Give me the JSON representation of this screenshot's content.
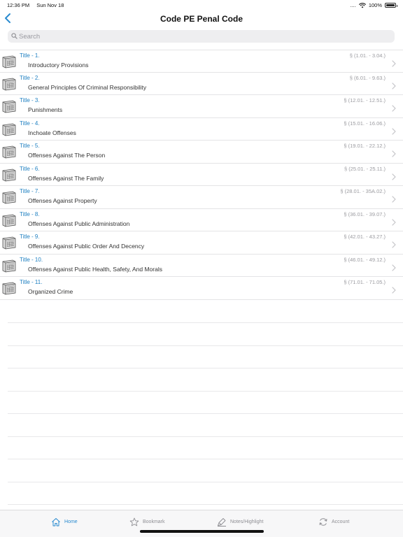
{
  "status": {
    "time": "12:36 PM",
    "date": "Sun Nov 18",
    "signal": "....",
    "battery": "100%"
  },
  "nav": {
    "title": "Code PE Penal Code"
  },
  "search": {
    "placeholder": "Search"
  },
  "titles": [
    {
      "title": "Title - 1.",
      "name": "Introductory Provisions",
      "range": "§ (1.01. - 3.04.)"
    },
    {
      "title": "Title - 2.",
      "name": "General Principles Of Criminal Responsibility",
      "range": "§ (6.01. - 9.63.)"
    },
    {
      "title": "Title - 3.",
      "name": "Punishments",
      "range": "§ (12.01. - 12.51.)"
    },
    {
      "title": "Title - 4.",
      "name": "Inchoate Offenses",
      "range": "§ (15.01. - 16.06.)"
    },
    {
      "title": "Title - 5.",
      "name": "Offenses Against The Person",
      "range": "§ (19.01. - 22.12.)"
    },
    {
      "title": "Title - 6.",
      "name": "Offenses Against The Family",
      "range": "§ (25.01. - 25.11.)"
    },
    {
      "title": "Title - 7.",
      "name": "Offenses Against Property",
      "range": "§ (28.01. - 35A.02.)"
    },
    {
      "title": "Title - 8.",
      "name": "Offenses Against Public Administration",
      "range": "§ (36.01. - 39.07.)"
    },
    {
      "title": "Title - 9.",
      "name": "Offenses Against Public Order And Decency",
      "range": "§ (42.01. - 43.27.)"
    },
    {
      "title": "Title - 10.",
      "name": "Offenses Against Public Health, Safety, And Morals",
      "range": "§ (46.01. - 49.12.)"
    },
    {
      "title": "Title - 11.",
      "name": "Organized Crime",
      "range": "§ (71.01. - 71.05.)"
    }
  ],
  "tabs": [
    {
      "label": "Home",
      "icon": "home-icon",
      "active": true
    },
    {
      "label": "Bookmark",
      "icon": "star-icon",
      "active": false
    },
    {
      "label": "Notes/Highlight",
      "icon": "highlighter-icon",
      "active": false
    },
    {
      "label": "Account",
      "icon": "sync-icon",
      "active": false
    }
  ],
  "colors": {
    "accent": "#2a8bd0",
    "title_blue": "#1d7fc1",
    "range_gray": "#9b9ba0"
  }
}
